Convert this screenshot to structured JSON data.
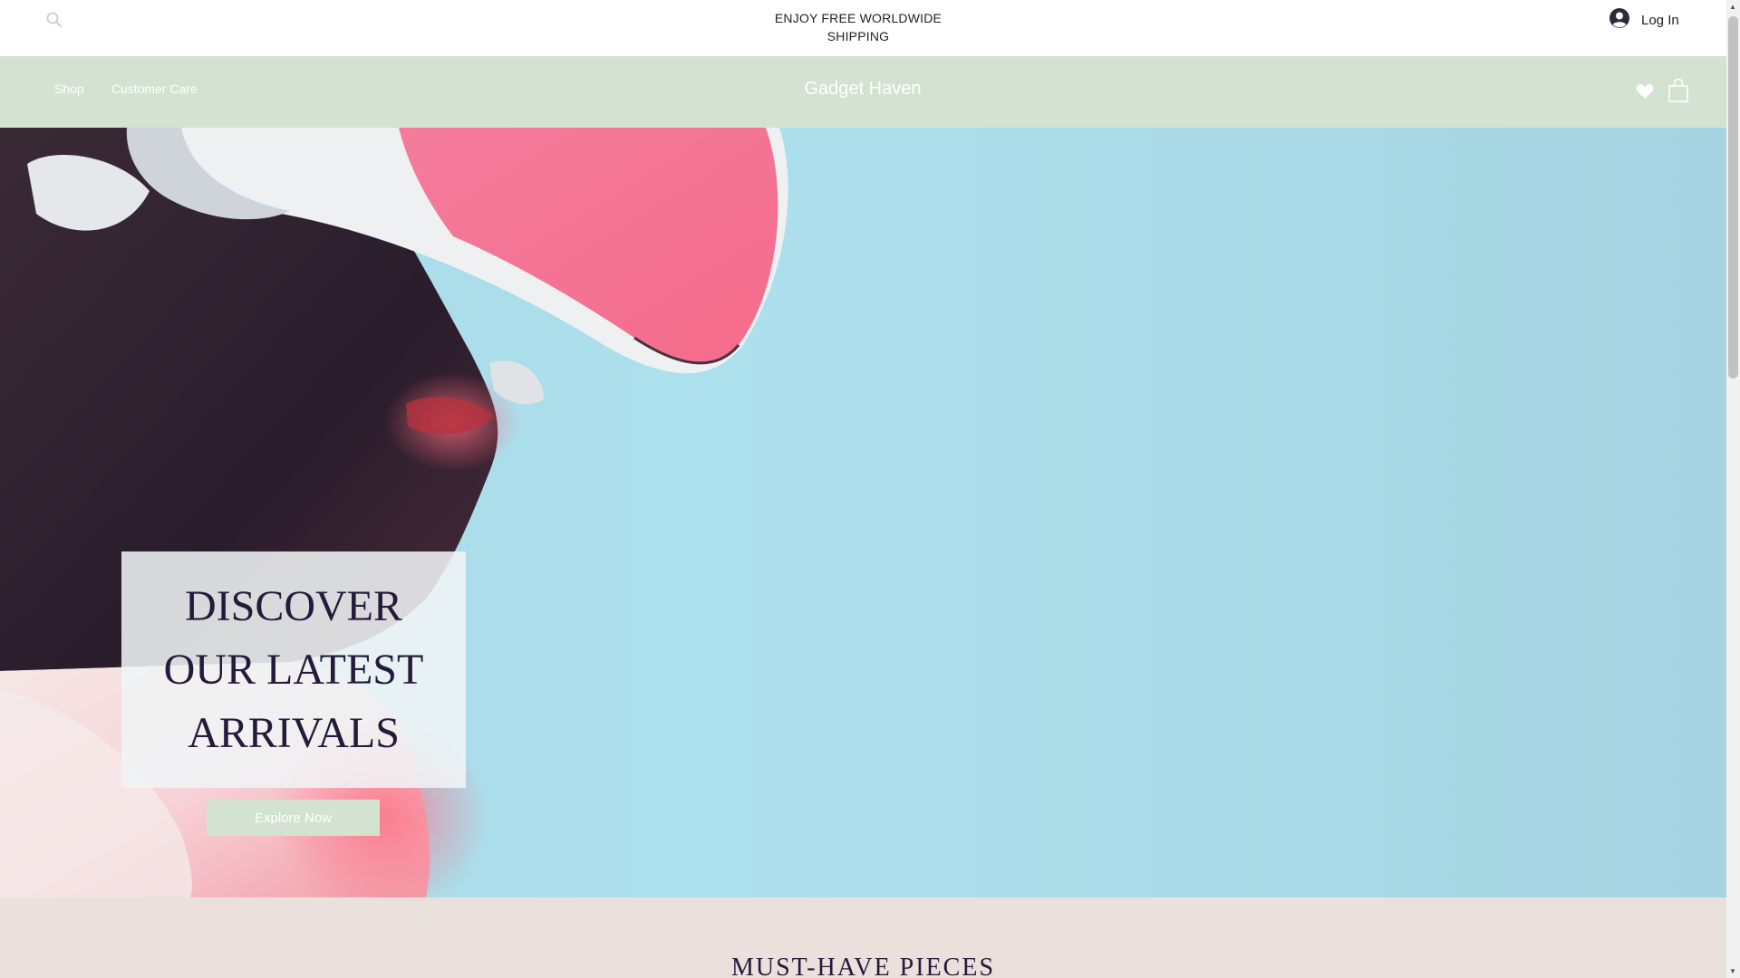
{
  "announcement": {
    "text": "ENJOY FREE WORLDWIDE SHIPPING"
  },
  "header": {
    "search_icon": "search-icon",
    "login_label": "Log In",
    "login_icon": "user-avatar-icon"
  },
  "nav": {
    "links": [
      {
        "label": "Shop"
      },
      {
        "label": "Customer Care"
      }
    ],
    "brand": "Gadget Haven",
    "wishlist_icon": "heart-icon",
    "cart_icon": "shopping-bag-icon",
    "background_color": "#d4e2d2"
  },
  "hero": {
    "title": "DISCOVER OUR LATEST ARRIVALS",
    "cta_label": "Explore Now",
    "background_color": "#ace0ec"
  },
  "section": {
    "title": "MUST-HAVE PIECES",
    "background_color": "#eae0dc"
  }
}
